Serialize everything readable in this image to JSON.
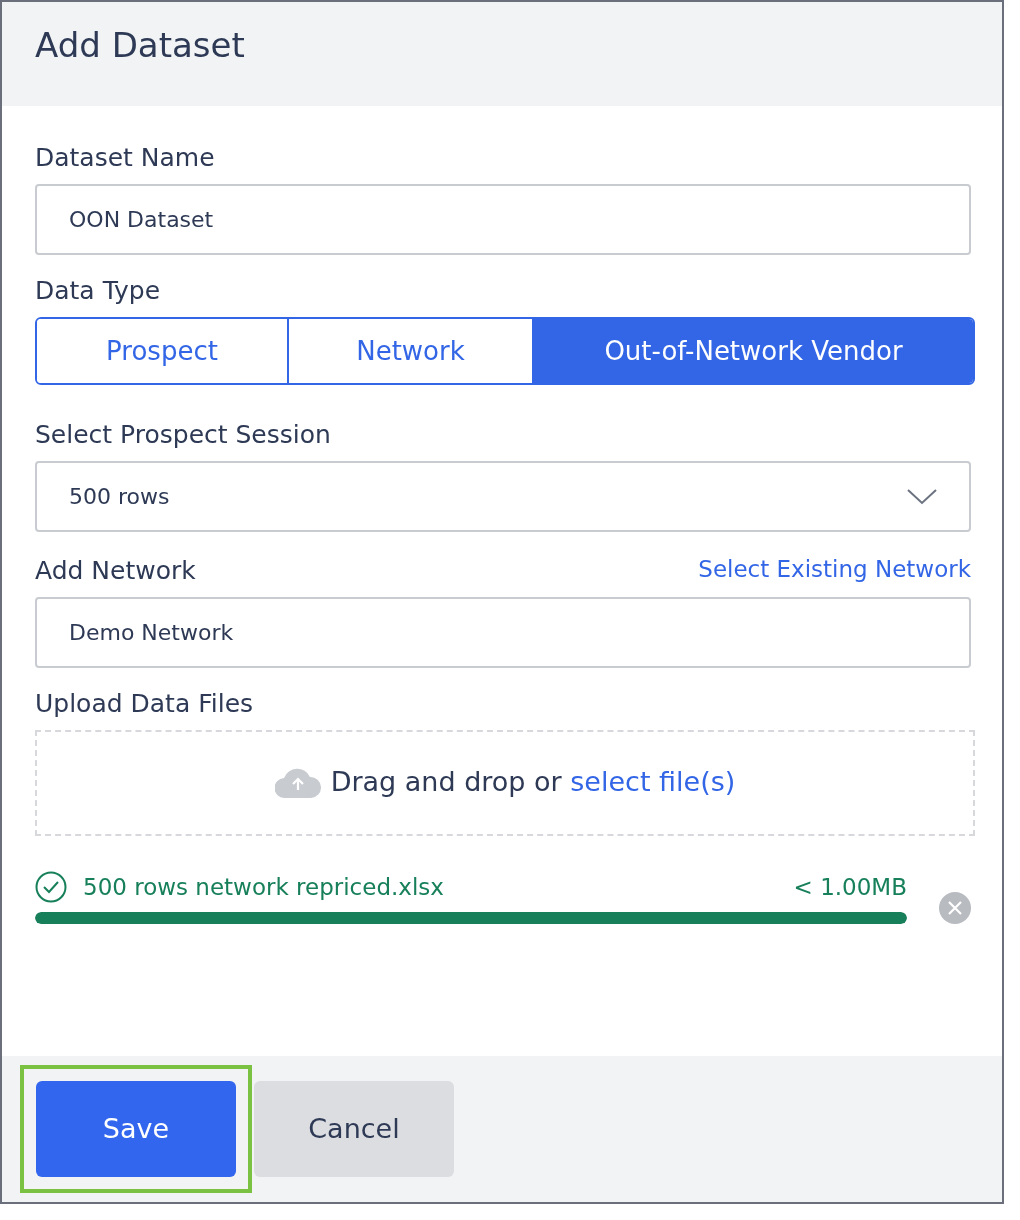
{
  "dialog": {
    "title": "Add Dataset"
  },
  "dataset_name": {
    "label": "Dataset Name",
    "value": "OON Dataset"
  },
  "data_type": {
    "label": "Data Type",
    "options": [
      {
        "label": "Prospect",
        "selected": false
      },
      {
        "label": "Network",
        "selected": false
      },
      {
        "label": "Out-of-Network Vendor",
        "selected": true
      }
    ]
  },
  "prospect_session": {
    "label": "Select Prospect Session",
    "value": "500 rows"
  },
  "network": {
    "label": "Add Network",
    "link": "Select Existing Network",
    "value": "Demo Network"
  },
  "upload": {
    "label": "Upload Data Files",
    "prompt": "Drag and drop or",
    "link": "select file(s)"
  },
  "files": [
    {
      "name": "500 rows network repriced.xlsx",
      "size": "< 1.00MB",
      "level": 1.0
    }
  ],
  "buttons": [
    {
      "label": "Save",
      "kind": "primary",
      "highlighted": true
    },
    {
      "label": "Cancel",
      "kind": "secondary",
      "highlighted": false
    }
  ]
}
